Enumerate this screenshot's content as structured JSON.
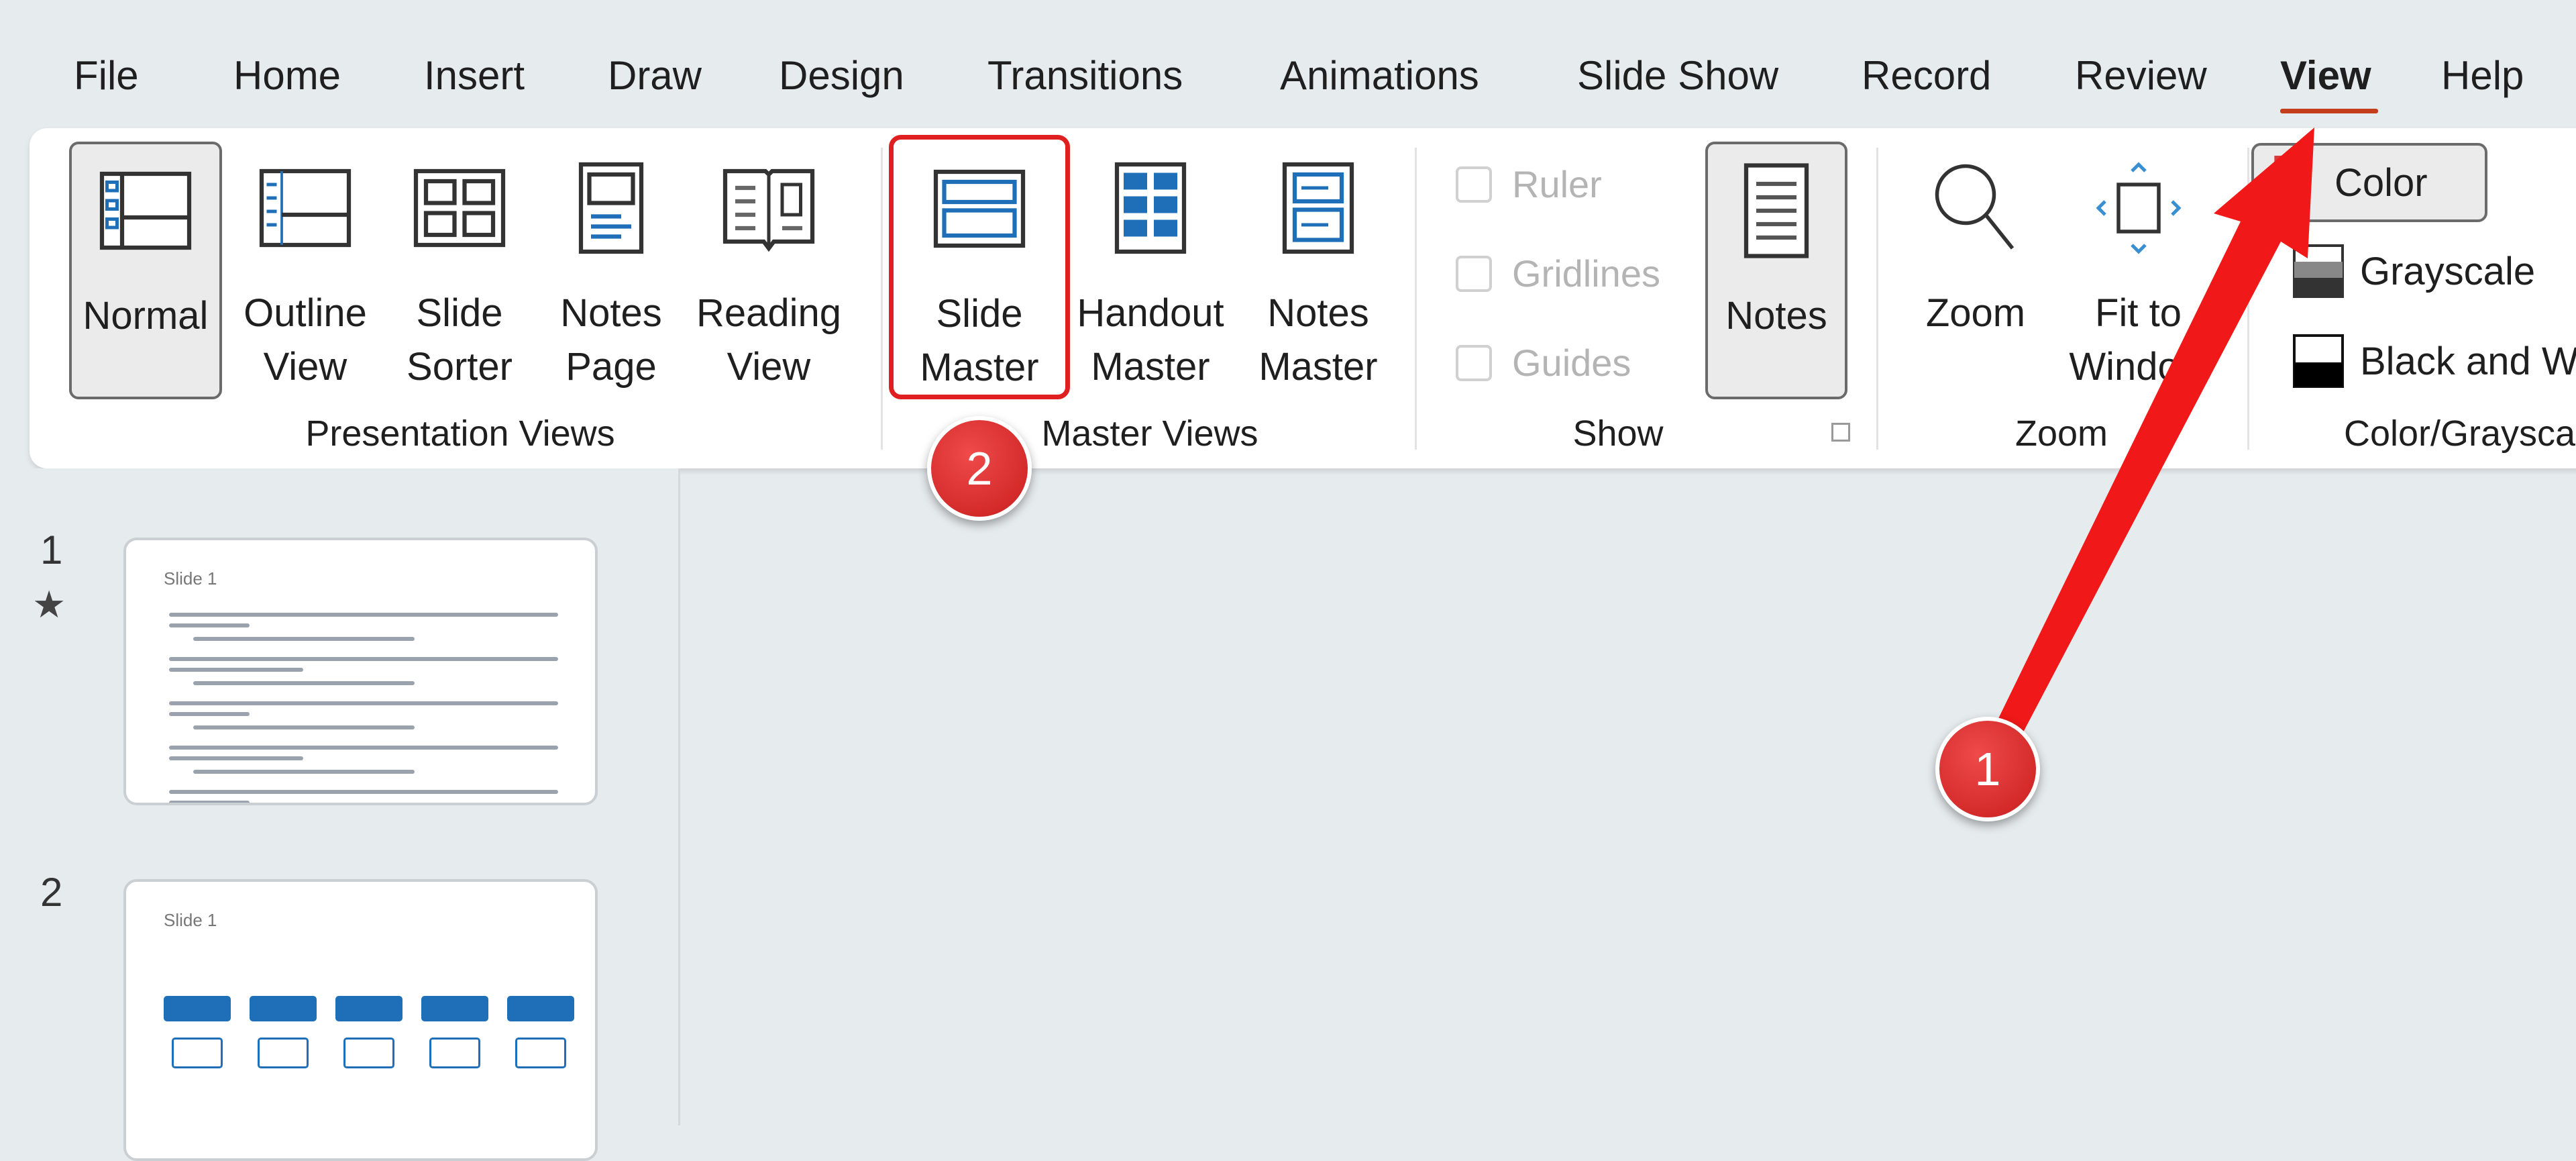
{
  "menu": {
    "tabs": [
      {
        "label": "File"
      },
      {
        "label": "Home"
      },
      {
        "label": "Insert"
      },
      {
        "label": "Draw"
      },
      {
        "label": "Design"
      },
      {
        "label": "Transitions"
      },
      {
        "label": "Animations"
      },
      {
        "label": "Slide Show"
      },
      {
        "label": "Record"
      },
      {
        "label": "Review"
      },
      {
        "label": "View"
      },
      {
        "label": "Help"
      }
    ],
    "active": "View"
  },
  "ribbon": {
    "presentation_views": {
      "label": "Presentation Views",
      "buttons": [
        {
          "l1": "Normal",
          "l2": "",
          "icon": "normal-view-icon",
          "pressed": true
        },
        {
          "l1": "Outline",
          "l2": "View",
          "icon": "outline-view-icon"
        },
        {
          "l1": "Slide",
          "l2": "Sorter",
          "icon": "slide-sorter-icon"
        },
        {
          "l1": "Notes",
          "l2": "Page",
          "icon": "notes-page-icon"
        },
        {
          "l1": "Reading",
          "l2": "View",
          "icon": "reading-view-icon"
        }
      ]
    },
    "master_views": {
      "label": "Master Views",
      "buttons": [
        {
          "l1": "Slide",
          "l2": "Master",
          "icon": "slide-master-icon",
          "highlighted": true
        },
        {
          "l1": "Handout",
          "l2": "Master",
          "icon": "handout-master-icon"
        },
        {
          "l1": "Notes",
          "l2": "Master",
          "icon": "notes-master-icon"
        }
      ]
    },
    "show": {
      "label": "Show",
      "checkboxes": [
        {
          "label": "Ruler",
          "checked": false,
          "disabled": true
        },
        {
          "label": "Gridlines",
          "checked": false,
          "disabled": true
        },
        {
          "label": "Guides",
          "checked": false,
          "disabled": true
        }
      ],
      "notes_button": {
        "label": "Notes",
        "pressed": true
      }
    },
    "zoom": {
      "label": "Zoom",
      "buttons": [
        {
          "l1": "Zoom",
          "l2": ""
        },
        {
          "l1": "Fit to",
          "l2": "Window"
        }
      ]
    },
    "color_grayscale": {
      "label": "Color/Grayscale",
      "items": [
        {
          "label": "Color",
          "pressed": true
        },
        {
          "label": "Grayscale"
        },
        {
          "label": "Black and White"
        }
      ]
    }
  },
  "slides": [
    {
      "number": "1",
      "title": "Slide 1",
      "starred": true
    },
    {
      "number": "2",
      "title": "Slide 1"
    }
  ],
  "annotations": [
    {
      "label": "1"
    },
    {
      "label": "2"
    }
  ],
  "colors": {
    "accent": "#c43e1c",
    "annotation_red": "#e02020",
    "icon_blue": "#1e6fb8"
  }
}
